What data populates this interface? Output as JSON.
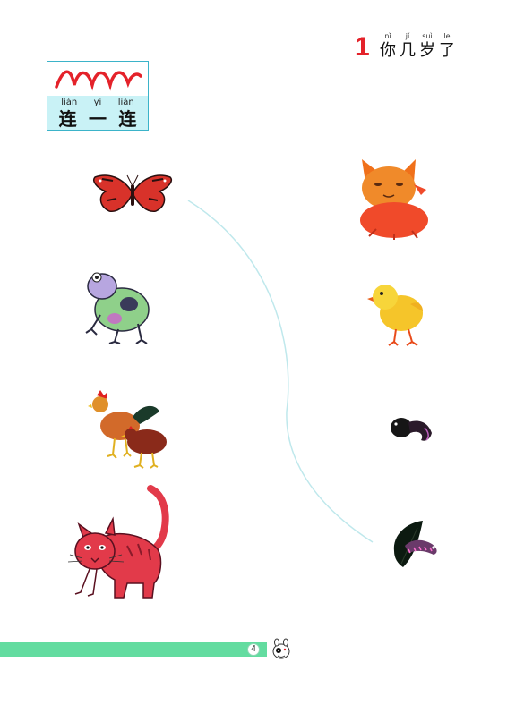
{
  "header": {
    "lesson_number": "1",
    "lesson_title": [
      {
        "pinyin": "nǐ",
        "char": "你"
      },
      {
        "pinyin": "jǐ",
        "char": "几"
      },
      {
        "pinyin": "suì",
        "char": "岁"
      },
      {
        "pinyin": "le",
        "char": "了"
      }
    ]
  },
  "activity": {
    "title": [
      {
        "pinyin": "lián",
        "char": "连"
      },
      {
        "pinyin": "yi",
        "char": "一"
      },
      {
        "pinyin": "lián",
        "char": "连"
      }
    ]
  },
  "left_column": [
    {
      "name": "butterfly",
      "icon": "butterfly-icon"
    },
    {
      "name": "frog",
      "icon": "frog-icon"
    },
    {
      "name": "rooster and hen",
      "icon": "chicken-icon"
    },
    {
      "name": "cat",
      "icon": "cat-icon"
    }
  ],
  "right_column": [
    {
      "name": "kitten",
      "icon": "kitten-icon"
    },
    {
      "name": "chick",
      "icon": "chick-icon"
    },
    {
      "name": "tadpole",
      "icon": "tadpole-icon"
    },
    {
      "name": "caterpillar",
      "icon": "caterpillar-icon"
    }
  ],
  "footer": {
    "page_number": "4"
  },
  "colors": {
    "accent_red": "#e4222a",
    "footer_green": "#63dca0",
    "title_box_bg": "#c9f2f6",
    "connector_line": "#bfe8ec"
  }
}
